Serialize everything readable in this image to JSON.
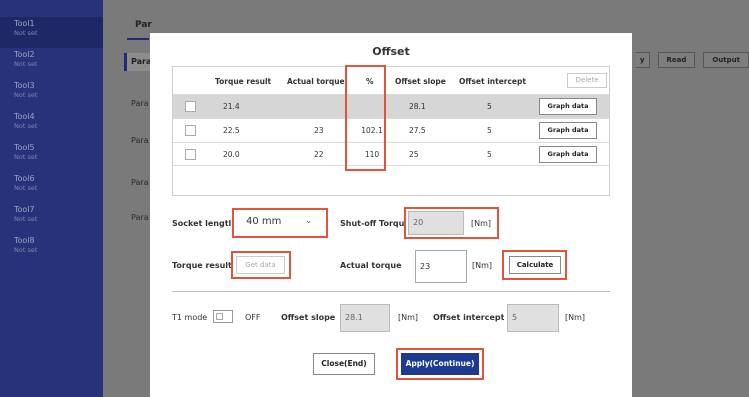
{
  "sidebar": {
    "items": [
      {
        "name": "Tool1",
        "status": "Not set"
      },
      {
        "name": "Tool2",
        "status": "Not set"
      },
      {
        "name": "Tool3",
        "status": "Not set"
      },
      {
        "name": "Tool4",
        "status": "Not set"
      },
      {
        "name": "Tool5",
        "status": "Not set"
      },
      {
        "name": "Tool6",
        "status": "Not set"
      },
      {
        "name": "Tool7",
        "status": "Not set"
      },
      {
        "name": "Tool8",
        "status": "Not set"
      }
    ]
  },
  "background": {
    "tab_label": "Par",
    "para_items": [
      "Para",
      "Para",
      "Para",
      "Para",
      "Para"
    ],
    "right_buttons": [
      "y",
      "Read",
      "Output"
    ]
  },
  "modal": {
    "title": "Offset",
    "table": {
      "headers": [
        "Torque result",
        "Actual torque",
        "%",
        "Offset slope",
        "Offset intercept"
      ],
      "delete_label": "Delete",
      "rows": [
        {
          "torque_result": "21.4",
          "actual_torque": "",
          "percent": "",
          "offset_slope": "28.1",
          "offset_intercept": "5",
          "button": "Graph data",
          "selected": true
        },
        {
          "torque_result": "22.5",
          "actual_torque": "23",
          "percent": "102.1",
          "offset_slope": "27.5",
          "offset_intercept": "5",
          "button": "Graph data",
          "selected": false
        },
        {
          "torque_result": "20.0",
          "actual_torque": "22",
          "percent": "110",
          "offset_slope": "25",
          "offset_intercept": "5",
          "button": "Graph data",
          "selected": false
        }
      ]
    },
    "socket_length_label": "Socket lengtl",
    "socket_length_value": "40 mm",
    "shutoff_label": "Shut-off Torqu",
    "shutoff_value": "20",
    "shutoff_unit": "[Nm]",
    "torque_result_label": "Torque result",
    "get_data_label": "Get data",
    "actual_torque_label": "Actual torque",
    "actual_torque_value": "23",
    "actual_torque_unit": "[Nm]",
    "calculate_label": "Calculate",
    "t1_mode_label": "T1 mode",
    "t1_toggle_state": "OFF",
    "offset_slope_label": "Offset slope",
    "offset_slope_value": "28.1",
    "offset_slope_unit": "[Nm]",
    "offset_intercept_label": "Offset intercept",
    "offset_intercept_value": "5",
    "offset_intercept_unit": "[Nm]",
    "close_label": "Close(End)",
    "apply_label": "Apply(Continue)"
  },
  "colors": {
    "sidebar_bg": "#27327a",
    "highlight_red": "#e2533b",
    "primary_button": "#1f3b91"
  }
}
